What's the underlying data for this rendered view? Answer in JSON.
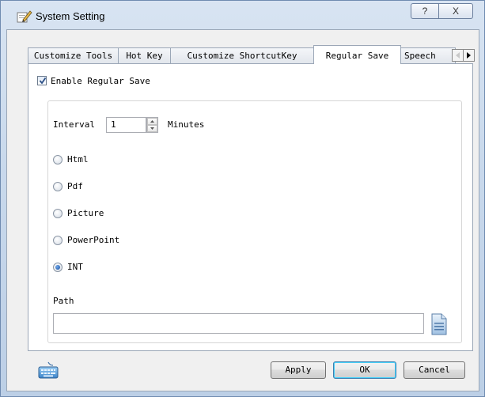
{
  "window": {
    "title": "System Setting",
    "help_glyph": "?",
    "close_glyph": "X"
  },
  "tabs": [
    {
      "label": "Customize Tools"
    },
    {
      "label": "Hot Key"
    },
    {
      "label": "Customize ShortcutKey"
    },
    {
      "label": "Regular Save",
      "active": true
    },
    {
      "label": "Speech"
    }
  ],
  "regular_save": {
    "enable_label": "Enable Regular Save",
    "enabled": true,
    "interval_label": "Interval",
    "interval_value": "1",
    "minutes_label": "Minutes",
    "formats": [
      {
        "label": "Html",
        "selected": false
      },
      {
        "label": "Pdf",
        "selected": false
      },
      {
        "label": "Picture",
        "selected": false
      },
      {
        "label": "PowerPoint",
        "selected": false
      },
      {
        "label": "INT",
        "selected": true
      }
    ],
    "path_label": "Path",
    "path_value": ""
  },
  "footer": {
    "apply_label": "Apply",
    "ok_label": "OK",
    "cancel_label": "Cancel"
  },
  "icons": {
    "app": "gear-pencil-icon",
    "keyboard": "keyboard-icon",
    "browse": "document-icon"
  },
  "colors": {
    "title_bar": "#c9d9ec",
    "active_tab": "#ffffff",
    "radio_selected": "#1a4f9c",
    "default_button_glow": "#48d0f8"
  }
}
